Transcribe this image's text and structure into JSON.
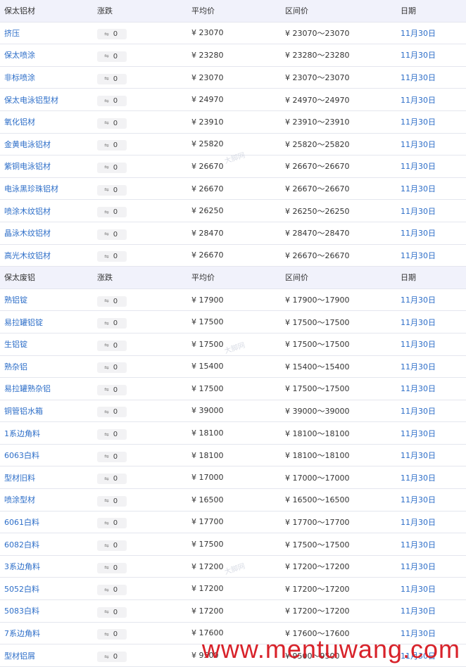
{
  "section1": {
    "headers": [
      "保太铝材",
      "涨跌",
      "平均价",
      "区间价",
      "日期"
    ],
    "rows": [
      {
        "name": "挤压",
        "change": "0",
        "avg": "¥ 23070",
        "range": "¥ 23070～23070",
        "date": "11月30日"
      },
      {
        "name": "保太喷涂",
        "change": "0",
        "avg": "¥ 23280",
        "range": "¥ 23280～23280",
        "date": "11月30日"
      },
      {
        "name": "非标喷涂",
        "change": "0",
        "avg": "¥ 23070",
        "range": "¥ 23070～23070",
        "date": "11月30日"
      },
      {
        "name": "保太电泳铝型材",
        "change": "0",
        "avg": "¥ 24970",
        "range": "¥ 24970～24970",
        "date": "11月30日"
      },
      {
        "name": "氧化铝材",
        "change": "0",
        "avg": "¥ 23910",
        "range": "¥ 23910～23910",
        "date": "11月30日"
      },
      {
        "name": "金黄电泳铝材",
        "change": "0",
        "avg": "¥ 25820",
        "range": "¥ 25820～25820",
        "date": "11月30日"
      },
      {
        "name": "紫铜电泳铝材",
        "change": "0",
        "avg": "¥ 26670",
        "range": "¥ 26670～26670",
        "date": "11月30日"
      },
      {
        "name": "电泳黑珍珠铝材",
        "change": "0",
        "avg": "¥ 26670",
        "range": "¥ 26670～26670",
        "date": "11月30日"
      },
      {
        "name": "喷涂木纹铝材",
        "change": "0",
        "avg": "¥ 26250",
        "range": "¥ 26250～26250",
        "date": "11月30日"
      },
      {
        "name": "晶泳木纹铝材",
        "change": "0",
        "avg": "¥ 28470",
        "range": "¥ 28470～28470",
        "date": "11月30日"
      },
      {
        "name": "高光木纹铝材",
        "change": "0",
        "avg": "¥ 26670",
        "range": "¥ 26670～26670",
        "date": "11月30日"
      }
    ]
  },
  "section2": {
    "headers": [
      "保太废铝",
      "涨跌",
      "平均价",
      "区间价",
      "日期"
    ],
    "rows": [
      {
        "name": "熟铝锭",
        "change": "0",
        "avg": "¥ 17900",
        "range": "¥ 17900～17900",
        "date": "11月30日"
      },
      {
        "name": "易拉罐铝锭",
        "change": "0",
        "avg": "¥ 17500",
        "range": "¥ 17500～17500",
        "date": "11月30日"
      },
      {
        "name": "生铝锭",
        "change": "0",
        "avg": "¥ 17500",
        "range": "¥ 17500～17500",
        "date": "11月30日"
      },
      {
        "name": "熟杂铝",
        "change": "0",
        "avg": "¥ 15400",
        "range": "¥ 15400～15400",
        "date": "11月30日"
      },
      {
        "name": "易拉罐熟杂铝",
        "change": "0",
        "avg": "¥ 17500",
        "range": "¥ 17500～17500",
        "date": "11月30日"
      },
      {
        "name": "铜管铝水箱",
        "change": "0",
        "avg": "¥ 39000",
        "range": "¥ 39000～39000",
        "date": "11月30日"
      },
      {
        "name": "1系边角料",
        "change": "0",
        "avg": "¥ 18100",
        "range": "¥ 18100～18100",
        "date": "11月30日"
      },
      {
        "name": "6063白料",
        "change": "0",
        "avg": "¥ 18100",
        "range": "¥ 18100～18100",
        "date": "11月30日"
      },
      {
        "name": "型材旧料",
        "change": "0",
        "avg": "¥ 17000",
        "range": "¥ 17000～17000",
        "date": "11月30日"
      },
      {
        "name": "喷涂型材",
        "change": "0",
        "avg": "¥ 16500",
        "range": "¥ 16500～16500",
        "date": "11月30日"
      },
      {
        "name": "6061白料",
        "change": "0",
        "avg": "¥ 17700",
        "range": "¥ 17700～17700",
        "date": "11月30日"
      },
      {
        "name": "6082白料",
        "change": "0",
        "avg": "¥ 17500",
        "range": "¥ 17500～17500",
        "date": "11月30日"
      },
      {
        "name": "3系边角料",
        "change": "0",
        "avg": "¥ 17200",
        "range": "¥ 17200～17200",
        "date": "11月30日"
      },
      {
        "name": "5052白料",
        "change": "0",
        "avg": "¥ 17200",
        "range": "¥ 17200～17200",
        "date": "11月30日"
      },
      {
        "name": "5083白料",
        "change": "0",
        "avg": "¥ 17200",
        "range": "¥ 17200～17200",
        "date": "11月30日"
      },
      {
        "name": "7系边角料",
        "change": "0",
        "avg": "¥ 17600",
        "range": "¥ 17600～17600",
        "date": "11月30日"
      },
      {
        "name": "型材铝屑",
        "change": "0",
        "avg": "¥ 9500",
        "range": "¥ 9500～9500",
        "date": "11月30日"
      }
    ]
  },
  "watermark": {
    "url": "www.mentuwang.com",
    "logo_text": "大脚网"
  },
  "icons": {
    "change_icon": "flat-trend-icon"
  },
  "colors": {
    "link": "#2d6ec8",
    "header_bg": "#f1f2fb",
    "watermark": "#d8222a"
  }
}
